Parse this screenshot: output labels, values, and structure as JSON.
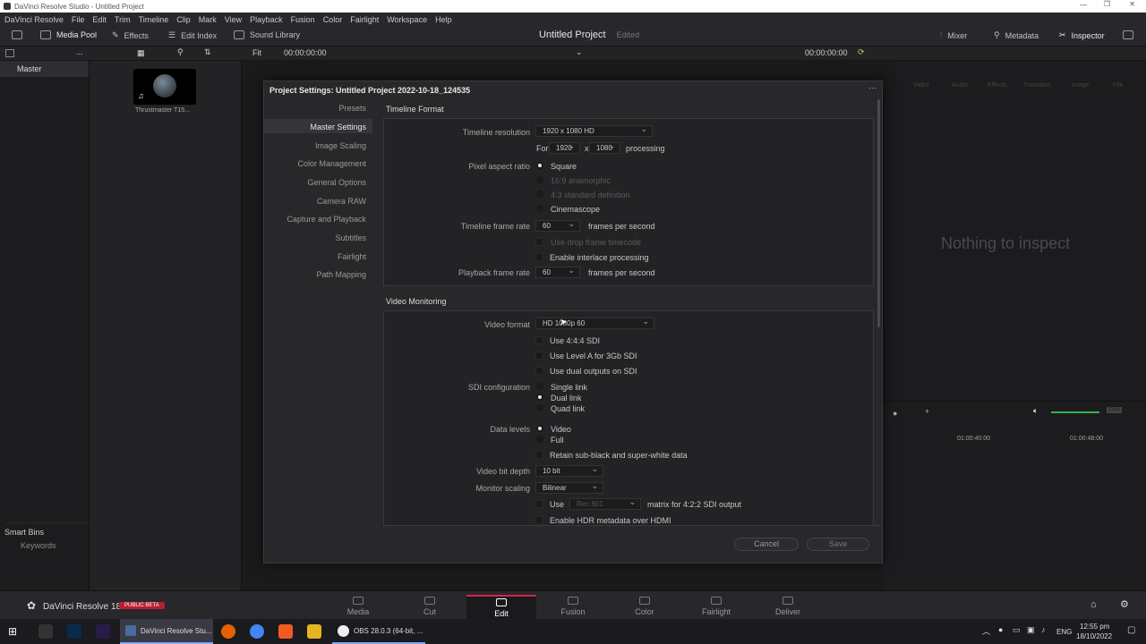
{
  "window": {
    "title": "DaVinci Resolve Studio - Untitled Project"
  },
  "menu": [
    "DaVinci Resolve",
    "File",
    "Edit",
    "Trim",
    "Timeline",
    "Clip",
    "Mark",
    "View",
    "Playback",
    "Fusion",
    "Color",
    "Fairlight",
    "Workspace",
    "Help"
  ],
  "toolbar": {
    "media_pool": "Media Pool",
    "effects": "Effects",
    "edit_index": "Edit Index",
    "sound_library": "Sound Library",
    "project_title": "Untitled Project",
    "edited": "Edited",
    "mixer": "Mixer",
    "metadata": "Metadata",
    "inspector": "Inspector"
  },
  "subbar": {
    "ellipsis": "...",
    "fit": "Fit",
    "tc_left": "00:00:00:00",
    "tc_right": "00:00:00:00"
  },
  "bins": {
    "master": "Master",
    "smart_bins": "Smart Bins",
    "keywords": "Keywords"
  },
  "pool": {
    "clip_name": "Thrustmaster T15..."
  },
  "inspector": {
    "tabs": [
      "Video",
      "Audio",
      "Effects",
      "Transition",
      "Image",
      "File"
    ],
    "empty": "Nothing to inspect"
  },
  "timeline": {
    "tc1": "01:00:40:00",
    "tc2": "01:00:48:00",
    "dim": "DIM"
  },
  "dialog": {
    "title": "Project Settings:  Untitled Project 2022-10-18_124535",
    "nav": [
      "Presets",
      "Master Settings",
      "Image Scaling",
      "Color Management",
      "General Options",
      "Camera RAW",
      "Capture and Playback",
      "Subtitles",
      "Fairlight",
      "Path Mapping"
    ],
    "timeline_format": {
      "heading": "Timeline Format",
      "resolution_label": "Timeline resolution",
      "resolution_value": "1920 x 1080 HD",
      "for": "For",
      "width": "1920",
      "x": "x",
      "height": "1080",
      "processing": "processing",
      "par_label": "Pixel aspect ratio",
      "par_options": [
        "Square",
        "16:9 anamorphic",
        "4:3 standard definition",
        "Cinemascope"
      ],
      "fps_label": "Timeline frame rate",
      "fps_value": "60",
      "fps_unit": "frames per second",
      "dropframe": "Use drop frame timecode",
      "interlace": "Enable interlace processing",
      "pb_label": "Playback frame rate",
      "pb_value": "60",
      "pb_unit": "frames per second"
    },
    "video_monitoring": {
      "heading": "Video Monitoring",
      "format_label": "Video format",
      "format_value": "HD 1080p 60",
      "use444": "Use 4:4:4 SDI",
      "levelA": "Use Level A for 3Gb SDI",
      "dual_out": "Use dual outputs on SDI",
      "sdi_label": "SDI configuration",
      "sdi_options": [
        "Single link",
        "Dual link",
        "Quad link"
      ],
      "levels_label": "Data levels",
      "levels_options": [
        "Video",
        "Full"
      ],
      "retain": "Retain sub-black and super-white data",
      "bitdepth_label": "Video bit depth",
      "bitdepth_value": "10 bit",
      "scaling_label": "Monitor scaling",
      "scaling_value": "Bilinear",
      "use": "Use",
      "matrix_value": "Rec.601",
      "matrix_text": "matrix for 4:2:2 SDI output",
      "hdr": "Enable HDR metadata over HDMI"
    },
    "cancel": "Cancel",
    "save": "Save"
  },
  "pages": {
    "app": "DaVinci Resolve 18",
    "badge": "PUBLIC BETA",
    "items": [
      "Media",
      "Cut",
      "Edit",
      "Fusion",
      "Color",
      "Fairlight",
      "Deliver"
    ],
    "active": "Edit"
  },
  "taskbar": {
    "resolve": "DaVinci Resolve Stu...",
    "obs": "OBS 28.0.3 (64-bit, ...",
    "lang": "ENG",
    "time": "12:55 pm",
    "date": "18/10/2022"
  },
  "colors": {
    "accent": "#d1254b",
    "bg": "#1e1e20",
    "dialog": "#28282b"
  }
}
